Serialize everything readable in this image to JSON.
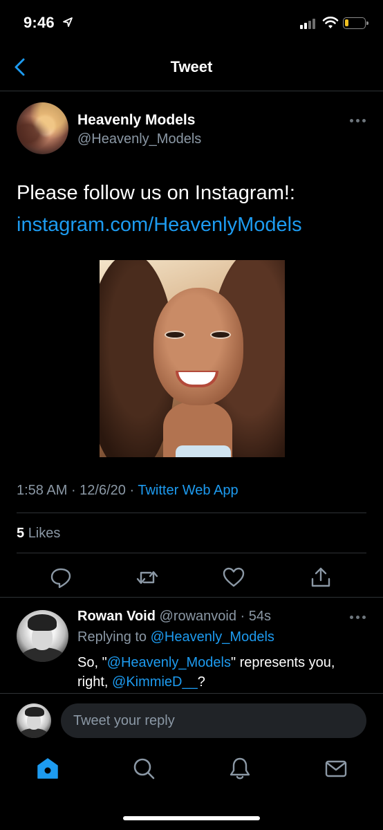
{
  "status_bar": {
    "time": "9:46"
  },
  "nav": {
    "title": "Tweet"
  },
  "tweet": {
    "author_name": "Heavenly Models",
    "author_handle": "@Heavenly_Models",
    "text": "Please follow us on Instagram!:",
    "link": "instagram.com/HeavenlyModels",
    "time": "1:58 AM",
    "date": "12/6/20",
    "source": "Twitter Web App",
    "likes_count": "5",
    "likes_label": "Likes"
  },
  "reply": {
    "name": "Rowan Void",
    "handle": "@rowanvoid",
    "age": "54s",
    "replying_to_label": "Replying to",
    "replying_to_handle": "@Heavenly_Models",
    "text_1": "So, \"",
    "mention_1": "@Heavenly_Models",
    "text_2": "\" represents you, right, ",
    "mention_2": "@KimmieD__",
    "text_3": "?"
  },
  "composer": {
    "placeholder": "Tweet your reply"
  },
  "colors": {
    "accent": "#1d9bf0",
    "muted": "#8b98a5",
    "background": "#000000",
    "divider": "#2f3336"
  },
  "icons": {
    "back": "chevron-left-icon",
    "actions": [
      "reply-icon",
      "retweet-icon",
      "like-icon",
      "share-icon"
    ],
    "tabs": [
      "home-icon",
      "search-icon",
      "notifications-icon",
      "messages-icon"
    ]
  }
}
